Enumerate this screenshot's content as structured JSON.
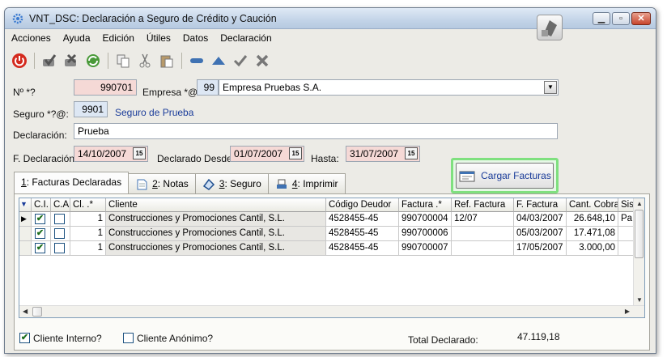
{
  "window": {
    "title": "VNT_DSC: Declaración a Seguro de Crédito y Caución"
  },
  "menu": [
    {
      "label": "Acciones"
    },
    {
      "label": "Ayuda"
    },
    {
      "label": "Edición"
    },
    {
      "label": "Útiles"
    },
    {
      "label": "Datos"
    },
    {
      "label": "Declaración"
    }
  ],
  "form": {
    "numero_label": "Nº *?",
    "numero_value": "990701",
    "empresa_label": "Empresa *@:",
    "empresa_code": "99",
    "empresa_name": "Empresa Pruebas S.A.",
    "seguro_label": "Seguro *?@:",
    "seguro_code": "9901",
    "seguro_name": "Seguro de Prueba",
    "declaracion_label": "Declaración:",
    "declaracion_value": "Prueba",
    "fdecl_label": "F. Declaración:",
    "fdecl_value": "14/10/2007",
    "desde_label": "Declarado Desde:",
    "desde_value": "01/07/2007",
    "hasta_label": "Hasta:",
    "hasta_value": "31/07/2007"
  },
  "cargar_button": "Cargar Facturas",
  "tabs": [
    {
      "key": "1",
      "label": ": Facturas Declaradas",
      "active": true
    },
    {
      "key": "2",
      "label": ": Notas"
    },
    {
      "key": "3",
      "label": ": Seguro"
    },
    {
      "key": "4",
      "label": ": Imprimir"
    }
  ],
  "table": {
    "columns": [
      "C.I.",
      "C.A.",
      "Cl. .*",
      "Cliente",
      "Código Deudor",
      "Factura .*",
      "Ref. Factura",
      "F. Factura",
      "Cant. Cobrar",
      "Sis"
    ],
    "rows": [
      {
        "ci": true,
        "ca": false,
        "cl": "1",
        "cliente": "Construcciones y Promociones Cantil, S.L.",
        "codigo": "4528455-45",
        "factura": "990700004",
        "ref": "12/07",
        "fecha": "04/03/2007",
        "cantidad": "26.648,10",
        "sis": "Pa"
      },
      {
        "ci": true,
        "ca": false,
        "cl": "1",
        "cliente": "Construcciones y Promociones Cantil, S.L.",
        "codigo": "4528455-45",
        "factura": "990700006",
        "ref": "",
        "fecha": "05/03/2007",
        "cantidad": "17.471,08",
        "sis": ""
      },
      {
        "ci": true,
        "ca": false,
        "cl": "1",
        "cliente": "Construcciones y Promociones Cantil, S.L.",
        "codigo": "4528455-45",
        "factura": "990700007",
        "ref": "",
        "fecha": "17/05/2007",
        "cantidad": "3.000,00",
        "sis": ""
      }
    ]
  },
  "footer": {
    "cliente_interno_label": "Cliente Interno?",
    "cliente_interno_checked": true,
    "cliente_anonimo_label": "Cliente Anónimo?",
    "cliente_anonimo_checked": false,
    "total_label": "Total Declarado:",
    "total_value": "47.119,18"
  }
}
